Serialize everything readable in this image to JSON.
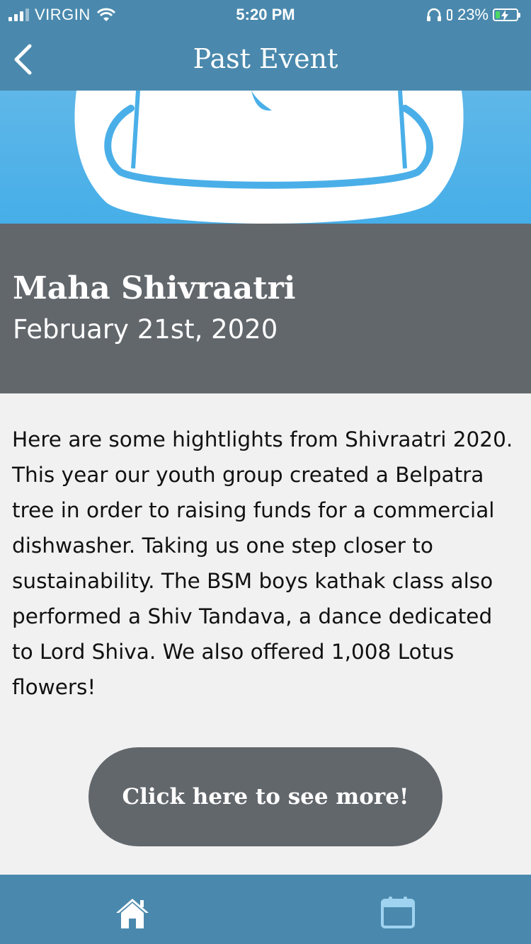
{
  "status_bar": {
    "carrier": "VIRGIN",
    "time": "5:20 PM",
    "battery_percent": "23%",
    "battery_level": 0.23,
    "signal_bars": 3
  },
  "nav": {
    "title": "Past Event",
    "back_icon": "chevron-left-icon"
  },
  "event": {
    "title": "Maha Shivraatri",
    "date": "February 21st, 2020",
    "description": "Here are some hightlights from Shivraatri 2020. This year our youth group created a Belpatra tree in order to raising funds for a commercial dishwasher. Taking us one step closer to sustainability. The BSM boys kathak class also performed a Shiv Tandava, a dance dedicated to Lord Shiva. We also offered 1,008 Lotus flowers!"
  },
  "actions": {
    "see_more_label": "Click here to see more!"
  },
  "tab_bar": {
    "items": [
      {
        "icon": "home-icon",
        "active": true
      },
      {
        "icon": "calendar-icon",
        "active": false
      }
    ]
  },
  "colors": {
    "header": "#4a89ad",
    "event_panel": "#62676c",
    "hero_blue": "#4aafe8",
    "background": "#f1f1f1"
  }
}
